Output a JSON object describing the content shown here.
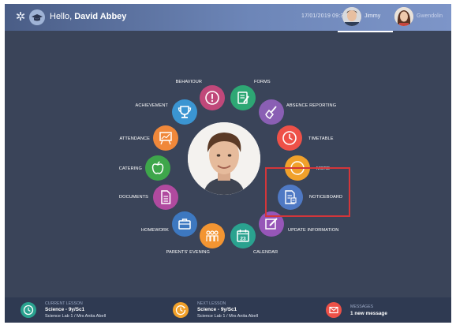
{
  "header": {
    "greeting_prefix": "Hello, ",
    "user_name": "David Abbey",
    "date": "17/01/2019 09:36",
    "children": [
      {
        "name": "Jimmy"
      },
      {
        "name": "Gwendolin"
      }
    ]
  },
  "menu": {
    "behaviour": "BEHAVIOUR",
    "forms": "FORMS",
    "achievement": "ACHIEVEMENT",
    "absence_reporting": "ABSENCE REPORTING",
    "attendance": "ATTENDANCE",
    "timetable": "TIMETABLE",
    "catering": "CATERING",
    "more": "MORE",
    "documents": "DOCUMENTS",
    "noticeboard": "NOTICEBOARD",
    "homework": "HOMEWORK",
    "update_information": "UPDATE INFORMATION",
    "parents_evening": "PARENTS' EVENING",
    "calendar": "CALENDAR",
    "calendar_day": "23"
  },
  "footer": {
    "current_lesson": {
      "title": "CURRENT LESSON",
      "subject": "Science - 9y/Sc1",
      "room": "Science Lab 1 / Mrs Anita Abell"
    },
    "next_lesson": {
      "title": "NEXT LESSON",
      "subject": "Science - 9y/Sc1",
      "room": "Science Lab 1 / Mrs Anita Abell"
    },
    "messages": {
      "title": "MESSAGES",
      "count": "1 new message"
    }
  },
  "colors": {
    "header_gradient_start": "#4a5d86",
    "header_gradient_end": "#7d95c8",
    "background": "#3a4459",
    "highlight": "#d3363a",
    "behaviour": "#c0487a",
    "forms": "#2ea774",
    "achievement": "#3b95d2",
    "absence_reporting": "#8a5fb4",
    "attendance": "#f0883a",
    "timetable": "#ee5148",
    "catering": "#3ea64b",
    "more": "#f1a12b",
    "documents": "#b04a9f",
    "noticeboard": "#4f79c4",
    "homework": "#3d78c0",
    "update_information": "#9656b8",
    "parents_evening": "#f39532",
    "calendar": "#2aa28f"
  },
  "icons": {
    "settings": "gear-icon",
    "logo": "graduation-cap-icon",
    "behaviour": "exclamation-circle-icon",
    "forms": "form-edit-icon",
    "achievement": "trophy-icon",
    "absence_reporting": "broom-icon",
    "attendance": "presentation-board-icon",
    "timetable": "clock-icon",
    "catering": "apple-icon",
    "more": "ellipsis-icon",
    "documents": "document-icon",
    "noticeboard": "noticeboard-icon",
    "homework": "briefcase-icon",
    "update_information": "pencil-square-icon",
    "parents_evening": "people-icon",
    "calendar": "calendar-icon",
    "current_lesson": "clock-icon",
    "next_lesson": "clock-next-icon",
    "messages": "envelope-icon"
  }
}
